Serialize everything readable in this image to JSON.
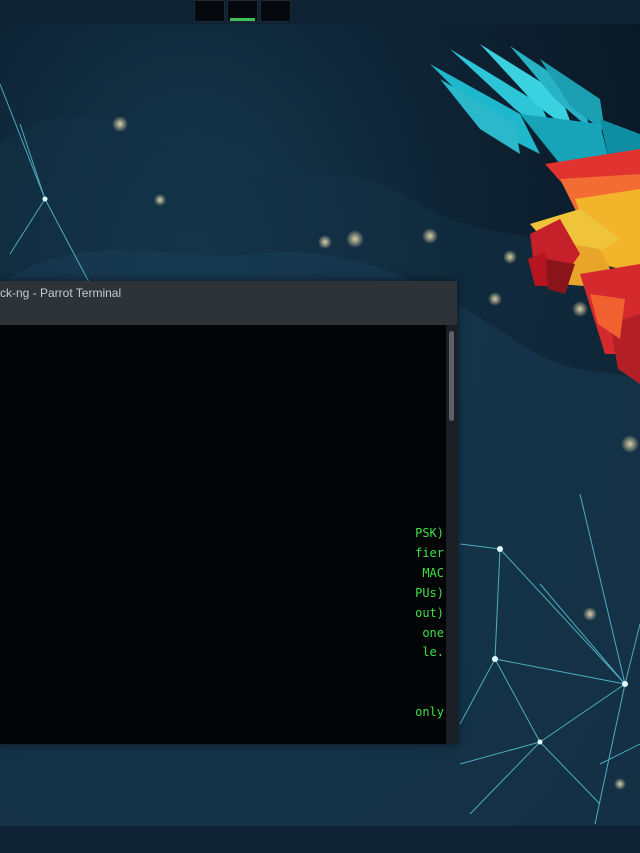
{
  "top_panel": {
    "workspaces": [
      {
        "index": 1,
        "active": false
      },
      {
        "index": 2,
        "active": true
      },
      {
        "index": 3,
        "active": false
      }
    ],
    "active_indicator_color": "#3dbf5a"
  },
  "terminal": {
    "title": "ck-ng - Parrot Terminal",
    "text_color": "#3fe048",
    "lines": [
      "PSK)",
      "fier",
      " MAC",
      "PUs)",
      "out)",
      " one",
      "le.",
      "",
      "",
      "only"
    ]
  },
  "wallpaper": {
    "theme_colors": {
      "network_lines": "#5fd6e8",
      "background_dark": "#07121c",
      "parrot_red": "#e0332f",
      "parrot_cyan": "#2cc6d8",
      "parrot_yellow": "#f2b42a"
    },
    "icons": [
      "parrot-logo-icon"
    ]
  }
}
